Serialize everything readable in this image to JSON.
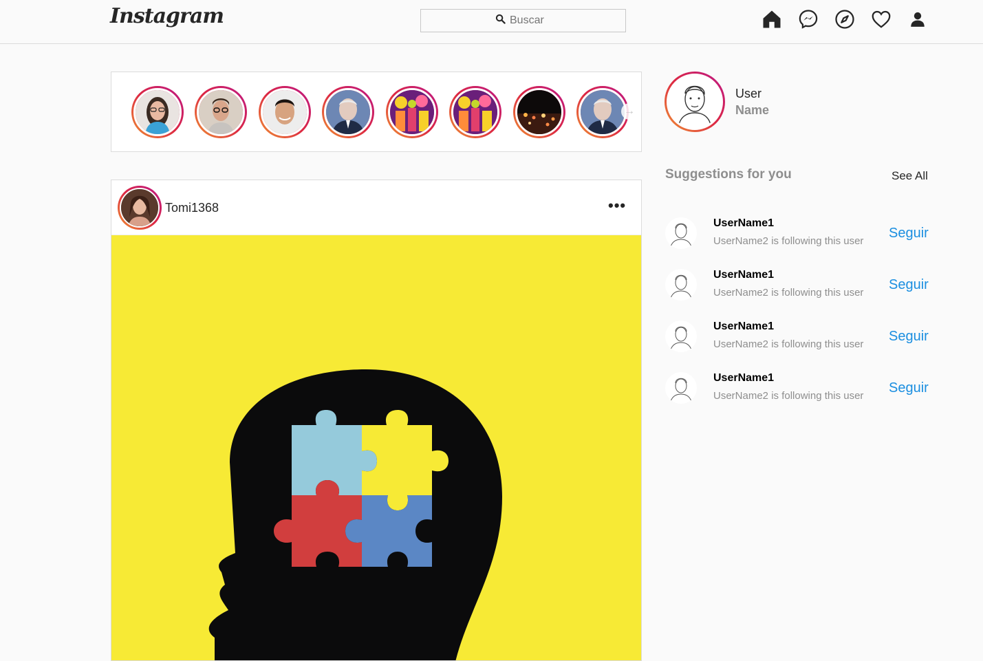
{
  "header": {
    "logo": "Instagram",
    "search_placeholder": "Buscar",
    "nav": [
      "home-icon",
      "messenger-icon",
      "explore-icon",
      "heart-icon",
      "profile-icon"
    ]
  },
  "stories": [
    {
      "label": "story-woman-glasses"
    },
    {
      "label": "story-man-glasses"
    },
    {
      "label": "story-man-smiling"
    },
    {
      "label": "story-man-suit"
    },
    {
      "label": "story-colorful-crowd"
    },
    {
      "label": "story-colorful-crowd-2"
    },
    {
      "label": "story-night-city"
    },
    {
      "label": "story-man-suit-2"
    }
  ],
  "post": {
    "username": "Tomi1368",
    "more": "•••"
  },
  "me": {
    "user": "User",
    "name": "Name"
  },
  "suggestions": {
    "title": "Suggestions for you",
    "see_all": "See All",
    "items": [
      {
        "name": "UserName1",
        "sub": "UserName2 is following this user",
        "action": "Seguir"
      },
      {
        "name": "UserName1",
        "sub": "UserName2 is following this user",
        "action": "Seguir"
      },
      {
        "name": "UserName1",
        "sub": "UserName2 is following this user",
        "action": "Seguir"
      },
      {
        "name": "UserName1",
        "sub": "UserName2 is following this user",
        "action": "Seguir"
      }
    ]
  },
  "colors": {
    "accent_link": "#1a8ee0",
    "post_background": "#f7ea35",
    "story_ring": "#dc2743"
  }
}
